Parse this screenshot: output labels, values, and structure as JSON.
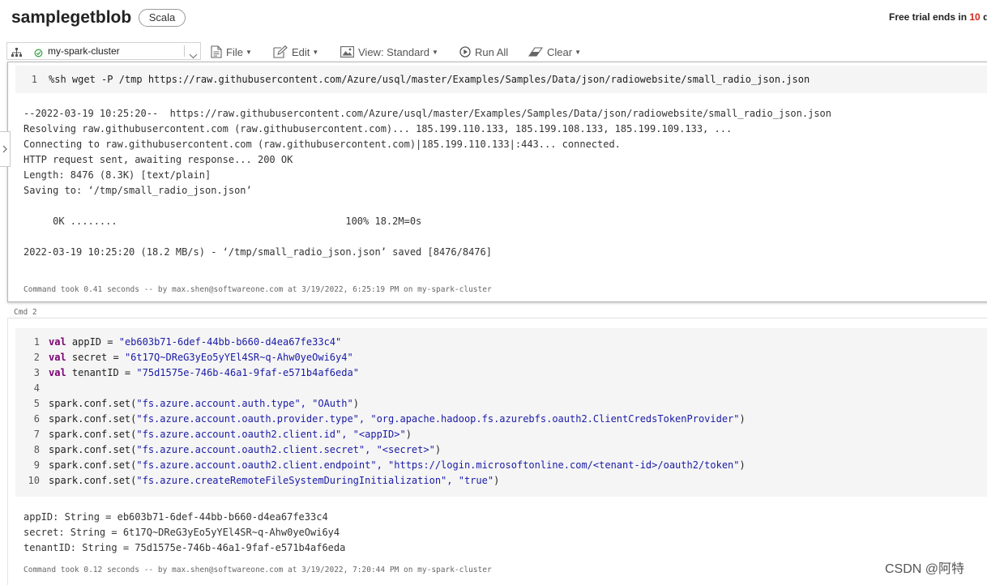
{
  "header": {
    "title": "samplegetblob",
    "language": "Scala",
    "trial_prefix": "Free trial ends in ",
    "trial_days": "10",
    "trial_suffix": " d"
  },
  "toolbar": {
    "cluster_name": "my-spark-cluster",
    "cluster_status_color": "#3ea64b",
    "file_label": "File",
    "edit_label": "Edit",
    "view_label": "View: Standard",
    "run_all_label": "Run All",
    "clear_label": "Clear"
  },
  "cell1": {
    "code": [
      {
        "n": "1",
        "text": "%sh wget -P /tmp https://raw.githubusercontent.com/Azure/usql/master/Examples/Samples/Data/json/radiowebsite/small_radio_json.json"
      }
    ],
    "output": [
      "--2022-03-19 10:25:20--  https://raw.githubusercontent.com/Azure/usql/master/Examples/Samples/Data/json/radiowebsite/small_radio_json.json",
      "Resolving raw.githubusercontent.com (raw.githubusercontent.com)... 185.199.110.133, 185.199.108.133, 185.199.109.133, ...",
      "Connecting to raw.githubusercontent.com (raw.githubusercontent.com)|185.199.110.133|:443... connected.",
      "HTTP request sent, awaiting response... 200 OK",
      "Length: 8476 (8.3K) [text/plain]",
      "Saving to: ‘/tmp/small_radio_json.json’",
      "",
      "     0K ........                                       100% 18.2M=0s",
      "",
      "2022-03-19 10:25:20 (18.2 MB/s) - ‘/tmp/small_radio_json.json’ saved [8476/8476]"
    ],
    "command_took": "Command took 0.41 seconds -- by max.shen@softwareone.com at 3/19/2022, 6:25:19 PM on my-spark-cluster"
  },
  "cmd2_label": "Cmd 2",
  "cell2": {
    "code": [
      {
        "n": "1",
        "kw": "val",
        "rest": " appID = ",
        "str": "\"eb603b71-6def-44bb-b660-d4ea67fe33c4\"",
        "tail": ""
      },
      {
        "n": "2",
        "kw": "val",
        "rest": " secret = ",
        "str": "\"6t17Q~DReG3yEo5yYEl4SR~q-Ahw0yeOwi6y4\"",
        "tail": ""
      },
      {
        "n": "3",
        "kw": "val",
        "rest": " tenantID = ",
        "str": "\"75d1575e-746b-46a1-9faf-e571b4af6eda\"",
        "tail": ""
      },
      {
        "n": "4",
        "kw": "",
        "rest": "",
        "str": "",
        "tail": ""
      },
      {
        "n": "5",
        "kw": "",
        "rest": "spark.conf.set(",
        "str": "\"fs.azure.account.auth.type\", \"OAuth\"",
        "tail": ")"
      },
      {
        "n": "6",
        "kw": "",
        "rest": "spark.conf.set(",
        "str": "\"fs.azure.account.oauth.provider.type\", \"org.apache.hadoop.fs.azurebfs.oauth2.ClientCredsTokenProvider\"",
        "tail": ")"
      },
      {
        "n": "7",
        "kw": "",
        "rest": "spark.conf.set(",
        "str": "\"fs.azure.account.oauth2.client.id\", \"<appID>\"",
        "tail": ")"
      },
      {
        "n": "8",
        "kw": "",
        "rest": "spark.conf.set(",
        "str": "\"fs.azure.account.oauth2.client.secret\", \"<secret>\"",
        "tail": ")"
      },
      {
        "n": "9",
        "kw": "",
        "rest": "spark.conf.set(",
        "str": "\"fs.azure.account.oauth2.client.endpoint\", \"https://login.microsoftonline.com/<tenant-id>/oauth2/token\"",
        "tail": ")"
      },
      {
        "n": "10",
        "kw": "",
        "rest": "spark.conf.set(",
        "str": "\"fs.azure.createRemoteFileSystemDuringInitialization\", \"true\"",
        "tail": ")"
      }
    ],
    "output": [
      "appID: String = eb603b71-6def-44bb-b660-d4ea67fe33c4",
      "secret: String = 6t17Q~DReG3yEo5yYEl4SR~q-Ahw0yeOwi6y4",
      "tenantID: String = 75d1575e-746b-46a1-9faf-e571b4af6eda"
    ],
    "command_took": "Command took 0.12 seconds -- by max.shen@softwareone.com at 3/19/2022, 7:20:44 PM on my-spark-cluster"
  },
  "watermark": "CSDN @阿特"
}
